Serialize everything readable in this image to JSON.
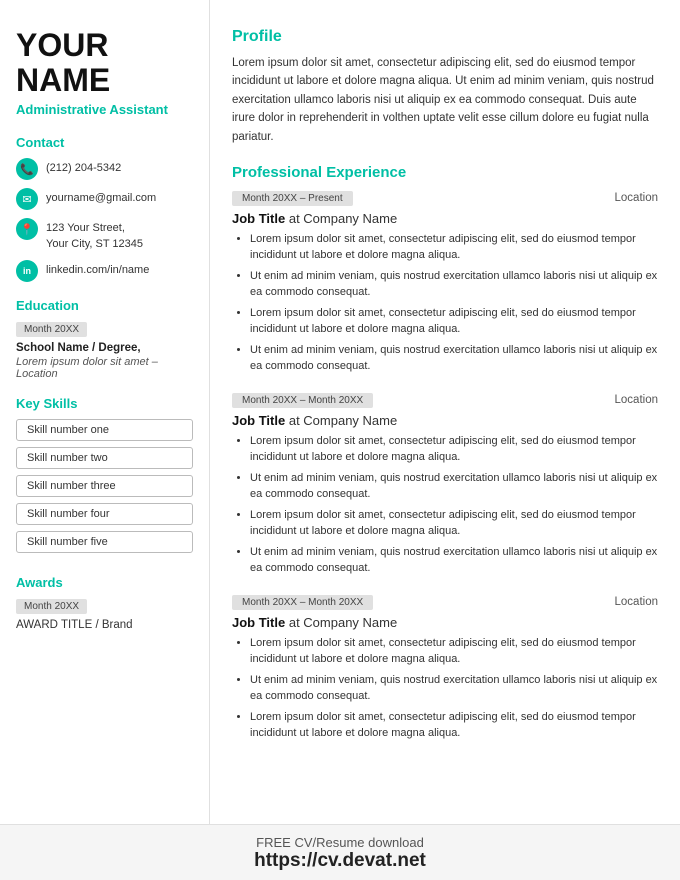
{
  "sidebar": {
    "first_name": "YOUR",
    "last_name": "NAME",
    "job_title": "Administrative Assistant",
    "contact_label": "Contact",
    "phone": "(212) 204-5342",
    "email": "yourname@gmail.com",
    "address_line1": "123 Your Street,",
    "address_line2": "Your City, ST 12345",
    "linkedin": "linkedin.com/in/name",
    "education_label": "Education",
    "edu_date": "Month 20XX",
    "edu_school": "School Name / Degree,",
    "edu_desc": "Lorem ipsum dolor sit amet – Location",
    "skills_label": "Key Skills",
    "skills": [
      "Skill number one",
      "Skill number two",
      "Skill number three",
      "Skill number four",
      "Skill number five"
    ],
    "awards_label": "Awards",
    "award_date": "Month 20XX",
    "award_title": "AWARD TITLE / Brand"
  },
  "main": {
    "profile_title": "Profile",
    "profile_text": "Lorem ipsum dolor sit amet, consectetur adipiscing elit, sed do eiusmod tempor incididunt ut labore et dolore magna aliqua. Ut enim ad minim veniam, quis nostrud exercitation ullamco laboris nisi ut aliquip ex ea commodo consequat. Duis aute irure dolor in reprehenderit in volthen uptate velit esse cillum dolore eu fugiat nulla pariatur.",
    "experience_title": "Professional Experience",
    "jobs": [
      {
        "date": "Month 20XX – Present",
        "location": "Location",
        "title": "Job Title",
        "company": "Company Name",
        "bullets": [
          "Lorem ipsum dolor sit amet, consectetur adipiscing elit, sed do eiusmod tempor incididunt ut labore et dolore magna aliqua.",
          "Ut enim ad minim veniam, quis nostrud exercitation ullamco laboris nisi ut aliquip ex ea commodo consequat.",
          "Lorem ipsum dolor sit amet, consectetur adipiscing elit, sed do eiusmod tempor incididunt ut labore et dolore magna aliqua.",
          "Ut enim ad minim veniam, quis nostrud exercitation ullamco laboris nisi ut aliquip ex ea commodo consequat."
        ]
      },
      {
        "date": "Month 20XX – Month 20XX",
        "location": "Location",
        "title": "Job Title",
        "company": "Company Name",
        "bullets": [
          "Lorem ipsum dolor sit amet, consectetur adipiscing elit, sed do eiusmod tempor incididunt ut labore et dolore magna aliqua.",
          "Ut enim ad minim veniam, quis nostrud exercitation ullamco laboris nisi ut aliquip ex ea commodo consequat.",
          "Lorem ipsum dolor sit amet, consectetur adipiscing elit, sed do eiusmod tempor incididunt ut labore et dolore magna aliqua.",
          "Ut enim ad minim veniam, quis nostrud exercitation ullamco laboris nisi ut aliquip ex ea commodo consequat."
        ]
      },
      {
        "date": "Month 20XX – Month 20XX",
        "location": "Location",
        "title": "Job Title",
        "company": "Company Name",
        "bullets": [
          "Lorem ipsum dolor sit amet, consectetur adipiscing elit, sed do eiusmod tempor incididunt ut labore et dolore magna aliqua.",
          "Ut enim ad minim veniam, quis nostrud exercitation ullamco laboris nisi ut aliquip ex ea commodo consequat.",
          "Lorem ipsum dolor sit amet, consectetur adipiscing elit, sed do eiusmod tempor incididunt ut labore et dolore magna aliqua."
        ]
      }
    ]
  },
  "footer": {
    "line1": "FREE CV/Resume download",
    "line2": "https://cv.devat.net"
  }
}
